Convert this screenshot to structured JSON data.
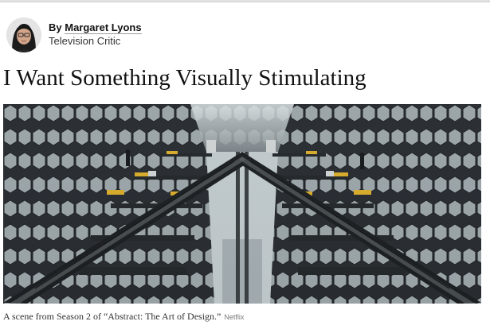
{
  "byline": {
    "prefix": "By",
    "author": "Margaret Lyons",
    "role": "Television Critic"
  },
  "headline": "I Want Something Visually Stimulating",
  "image": {
    "caption": "A scene from Season 2 of “Abstract: The Art of Design.”",
    "credit": "Netflix"
  },
  "colors": {
    "text": "#121212",
    "rule": "#e2e2e2",
    "caption": "#333333",
    "credit": "#777777"
  }
}
